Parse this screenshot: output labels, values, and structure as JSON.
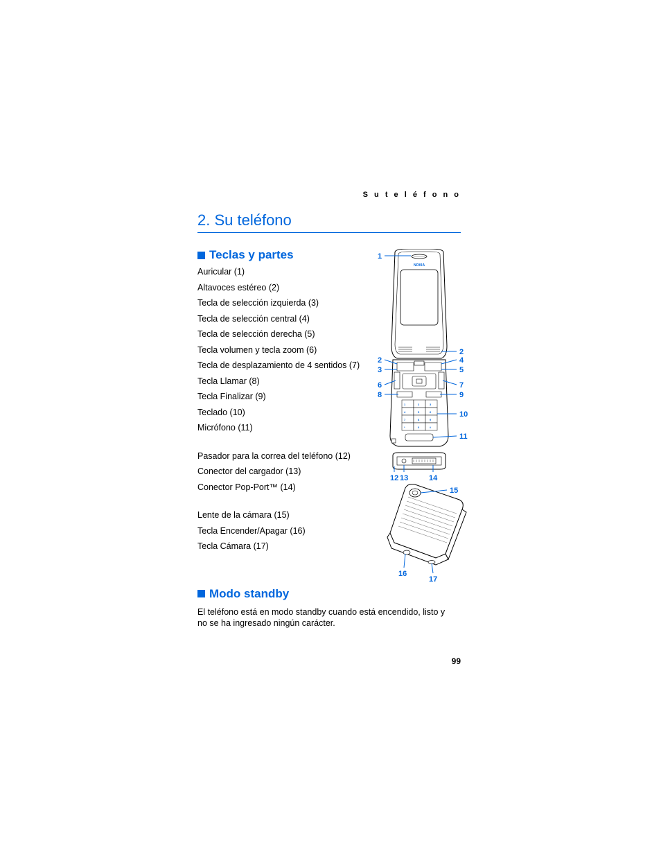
{
  "running_header": "S u  t e l é f o n o",
  "chapter_title": "2.   Su teléfono",
  "section1_title": "Teclas y partes",
  "parts_group1": [
    "Auricular (1)",
    "Altavoces estéreo (2)",
    "Tecla de selección izquierda (3)",
    "Tecla de selección central (4)",
    "Tecla de selección derecha (5)",
    "Tecla volumen y tecla zoom (6)",
    "Tecla de desplazamiento de 4 sentidos (7)",
    "Tecla Llamar (8)",
    "Tecla Finalizar (9)",
    "Teclado (10)",
    "Micrófono (11)"
  ],
  "parts_group2": [
    "Pasador para la correa del teléfono (12)",
    "Conector del cargador (13)",
    "Conector Pop-Port™ (14)"
  ],
  "parts_group3": [
    "Lente de la cámara (15)",
    "Tecla Encender/Apagar (16)",
    "Tecla Cámara (17)"
  ],
  "section2_title": "Modo standby",
  "standby_text": "El teléfono está en modo standby cuando está encendido, listo y no se ha ingresado ningún carácter.",
  "page_number": "99",
  "diagram": {
    "brand": "NOKIA",
    "callouts_left_top": [
      "1"
    ],
    "callouts_left_mid": [
      "2",
      "3",
      "6",
      "8"
    ],
    "callouts_right_mid": [
      "2",
      "4",
      "5",
      "7",
      "9",
      "10",
      "11"
    ],
    "callouts_bottom": [
      "12",
      "13",
      "14"
    ],
    "callouts_back": [
      "15",
      "16",
      "17"
    ]
  }
}
